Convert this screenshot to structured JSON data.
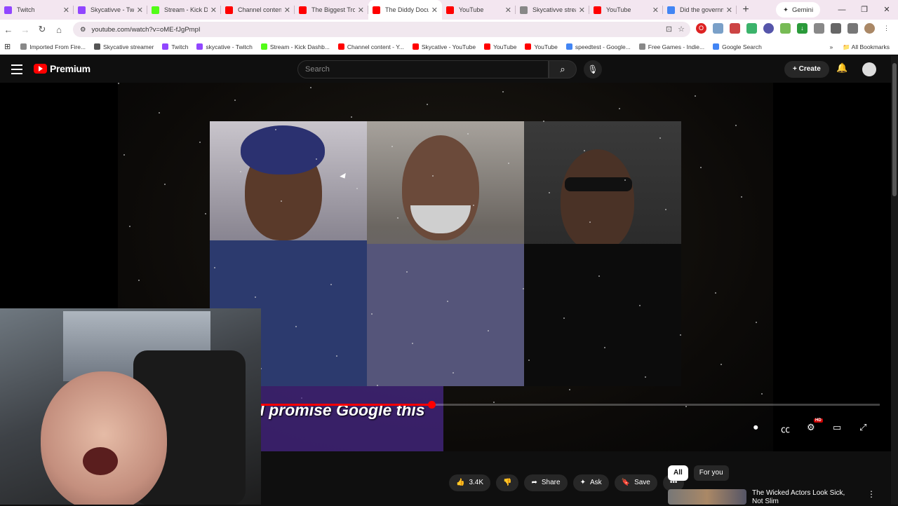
{
  "browser": {
    "tabs": [
      {
        "title": "Twitch",
        "color": "#9146ff",
        "active": false
      },
      {
        "title": "Skycativve - Twitch",
        "color": "#9146ff",
        "active": false
      },
      {
        "title": "Stream - Kick Dashboard",
        "color": "#53fc18",
        "active": false
      },
      {
        "title": "Channel content",
        "color": "#ff0000",
        "active": false
      },
      {
        "title": "The Biggest Trouble",
        "color": "#ff0000",
        "active": false
      },
      {
        "title": "The Diddy Documentary",
        "color": "#ff0000",
        "active": true
      },
      {
        "title": "YouTube",
        "color": "#ff0000",
        "active": false
      },
      {
        "title": "Skycativve stream",
        "color": "#888888",
        "active": false
      },
      {
        "title": "YouTube",
        "color": "#ff0000",
        "active": false
      },
      {
        "title": "Did the government",
        "color": "#4285f4",
        "active": false
      }
    ],
    "gemini_label": "Gemini",
    "url": "youtube.com/watch?v=oME-fJgPmpI",
    "bookmarks": [
      {
        "label": "Imported From Fire...",
        "color": "#888888"
      },
      {
        "label": "Skycative streamer",
        "color": "#555555"
      },
      {
        "label": "Twitch",
        "color": "#9146ff"
      },
      {
        "label": "skycative - Twitch",
        "color": "#9146ff"
      },
      {
        "label": "Stream - Kick Dashb...",
        "color": "#53fc18"
      },
      {
        "label": "Channel content - Y...",
        "color": "#ff0000"
      },
      {
        "label": "Skycative - YouTube",
        "color": "#ff0000"
      },
      {
        "label": "YouTube",
        "color": "#ff0000"
      },
      {
        "label": "YouTube",
        "color": "#ff0000"
      },
      {
        "label": "speedtest - Google...",
        "color": "#4285f4"
      },
      {
        "label": "Free Games - Indie...",
        "color": "#888888"
      },
      {
        "label": "Google Search",
        "color": "#4285f4"
      }
    ],
    "all_bookmarks_label": "All Bookmarks"
  },
  "youtube": {
    "logo_text": "Premium",
    "search_placeholder": "Search",
    "create_label": "Create",
    "caption": "I promise Google this",
    "progress": 0.275,
    "hd_badge": "HD",
    "like_count": "3.4K",
    "share_label": "Share",
    "ask_label": "Ask",
    "save_label": "Save",
    "chips": [
      "All",
      "For you"
    ],
    "recommended": {
      "title": "The Wicked Actors Look Sick, Not Slim"
    }
  }
}
